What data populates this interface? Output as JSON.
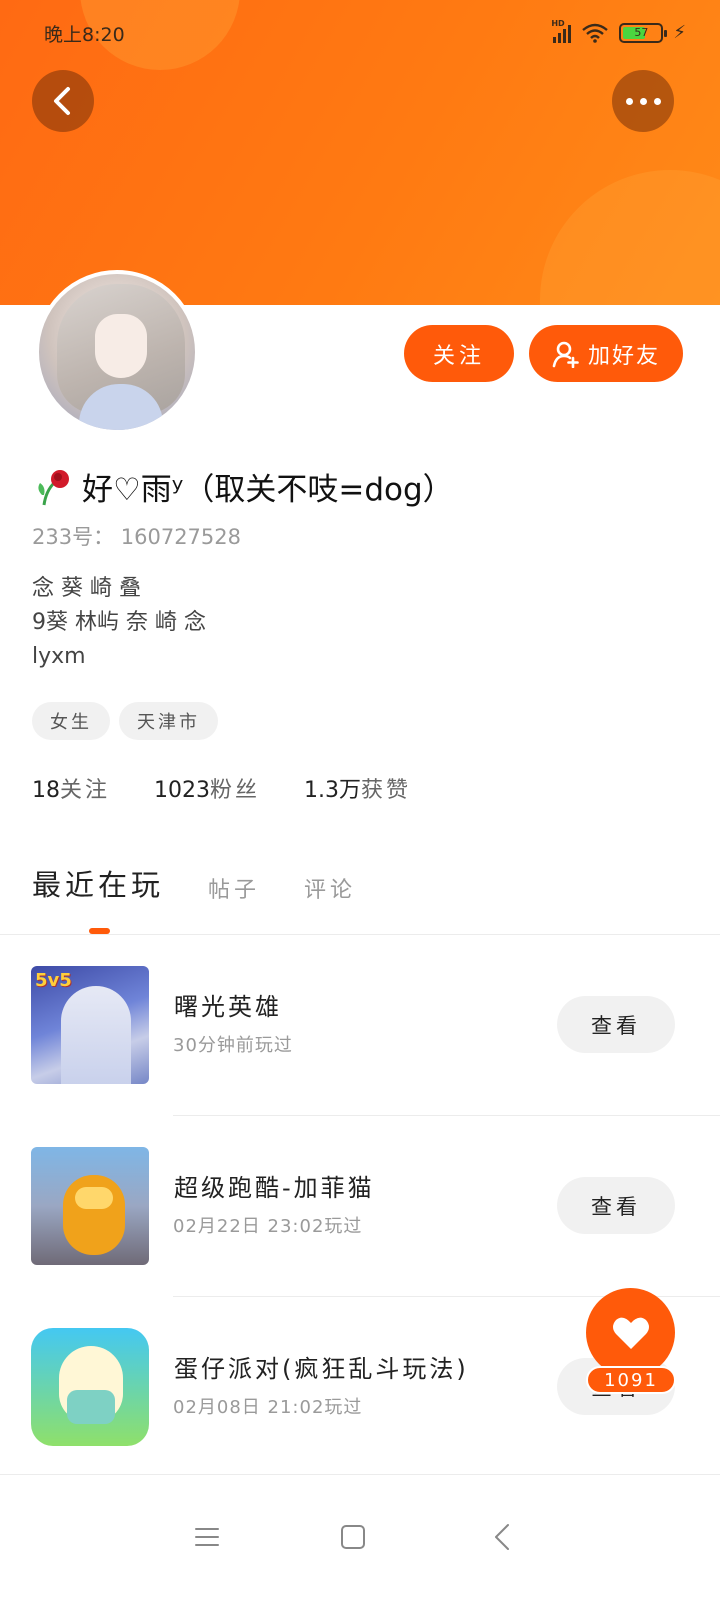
{
  "status_bar": {
    "time": "晚上8:20",
    "network_label": "HD",
    "battery_percent": "57"
  },
  "header": {
    "accent_color": "#ff6a13",
    "back_icon": "chevron-left-icon",
    "more_icon": "more-horizontal-icon"
  },
  "profile": {
    "follow_label": "关注",
    "add_friend_label": "加好友",
    "name": "好♡雨ʸ（取关不吱=dog）",
    "uid": "233号：  160727528",
    "bio": [
      "念 葵 崎 叠",
      "9葵 林屿 奈 崎 念",
      "lyxm"
    ],
    "tags": [
      "女生",
      "天津市"
    ],
    "stats": [
      {
        "value": "18",
        "label": "关注"
      },
      {
        "value": "1023",
        "label": "粉丝"
      },
      {
        "value": "1.3万",
        "label": "获赞"
      }
    ]
  },
  "tabs": {
    "items": [
      "最近在玩",
      "帖子",
      "评论"
    ],
    "active_index": 0
  },
  "games": [
    {
      "title": "曙光英雄",
      "time": "30分钟前玩过",
      "action": "查看",
      "badge": "5v5"
    },
    {
      "title": "超级跑酷-加菲猫",
      "time": "02月22日 23:02玩过",
      "action": "查看"
    },
    {
      "title": "蛋仔派对(疯狂乱斗玩法)",
      "time": "02月08日 21:02玩过",
      "action": "查看"
    }
  ],
  "like": {
    "count": "1091",
    "icon": "heart-icon"
  },
  "navbar": {
    "icons": [
      "menu-icon",
      "home-square-icon",
      "back-triangle-icon"
    ]
  }
}
